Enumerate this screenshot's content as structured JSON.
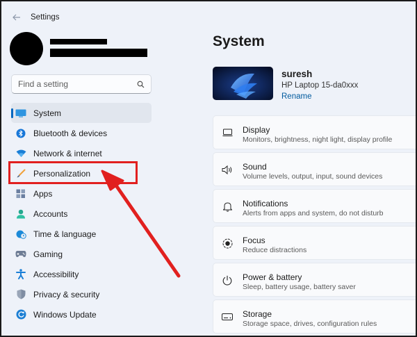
{
  "window": {
    "title": "Settings"
  },
  "search": {
    "placeholder": "Find a setting"
  },
  "sidebar": {
    "items": [
      {
        "label": "System",
        "icon": "system-icon",
        "selected": true
      },
      {
        "label": "Bluetooth & devices",
        "icon": "bluetooth-icon"
      },
      {
        "label": "Network & internet",
        "icon": "wifi-icon"
      },
      {
        "label": "Personalization",
        "icon": "brush-icon"
      },
      {
        "label": "Apps",
        "icon": "apps-icon"
      },
      {
        "label": "Accounts",
        "icon": "accounts-icon"
      },
      {
        "label": "Time & language",
        "icon": "clock-globe-icon"
      },
      {
        "label": "Gaming",
        "icon": "gamepad-icon"
      },
      {
        "label": "Accessibility",
        "icon": "accessibility-icon"
      },
      {
        "label": "Privacy & security",
        "icon": "shield-icon"
      },
      {
        "label": "Windows Update",
        "icon": "update-icon"
      }
    ]
  },
  "main": {
    "title": "System",
    "device": {
      "name": "suresh",
      "model": "HP Laptop 15-da0xxx",
      "rename": "Rename"
    },
    "cards": [
      {
        "title": "Display",
        "subtitle": "Monitors, brightness, night light, display profile",
        "icon": "display-icon"
      },
      {
        "title": "Sound",
        "subtitle": "Volume levels, output, input, sound devices",
        "icon": "speaker-icon"
      },
      {
        "title": "Notifications",
        "subtitle": "Alerts from apps and system, do not disturb",
        "icon": "bell-icon"
      },
      {
        "title": "Focus",
        "subtitle": "Reduce distractions",
        "icon": "focus-icon"
      },
      {
        "title": "Power & battery",
        "subtitle": "Sleep, battery usage, battery saver",
        "icon": "power-icon"
      },
      {
        "title": "Storage",
        "subtitle": "Storage space, drives, configuration rules",
        "icon": "storage-icon"
      }
    ]
  },
  "annotation": {
    "color": "#e1201f",
    "highlighted_item": "Personalization"
  }
}
